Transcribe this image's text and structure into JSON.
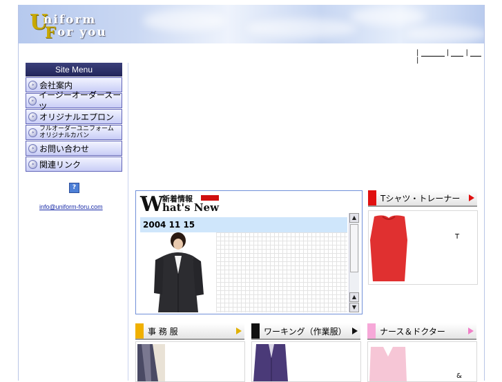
{
  "header": {
    "logo_cap1": "U",
    "logo_word1": "niform",
    "logo_cap2": "F",
    "logo_word2": "or you"
  },
  "topnav": {
    "sep": "|"
  },
  "sidebar": {
    "title": "Site Menu",
    "items": [
      {
        "label": "会社案内"
      },
      {
        "label": "イージーオーダースーツ"
      },
      {
        "label": "オリジナルエプロン"
      },
      {
        "label_line1": "フルオーダーユニフォーム",
        "label_line2": "オリジナルカバン"
      },
      {
        "label": "お問い合わせ"
      },
      {
        "label": "関連リンク"
      }
    ],
    "help_icon": "?",
    "email": "info@uniform-foru.com"
  },
  "news": {
    "head_W": "W",
    "head_jp": "新着情報",
    "head_en": "hat's New",
    "date": "2004  11  15"
  },
  "categories": {
    "tshirt": {
      "label": "Tシャツ・トレーナー",
      "note": "T",
      "mark_color": "#e01010",
      "arrow_color": "#e01010"
    },
    "office": {
      "label": "事 務 服",
      "mark_color": "#f0b000",
      "arrow_color": "#e0b000"
    },
    "working": {
      "label": "ワーキング（作業服）",
      "mark_color": "#111111",
      "arrow_color": "#111111"
    },
    "nurse": {
      "label": "ナース＆ドクター",
      "note": "&",
      "mark_color": "#f6a8d8",
      "arrow_color": "#f080c8"
    }
  }
}
